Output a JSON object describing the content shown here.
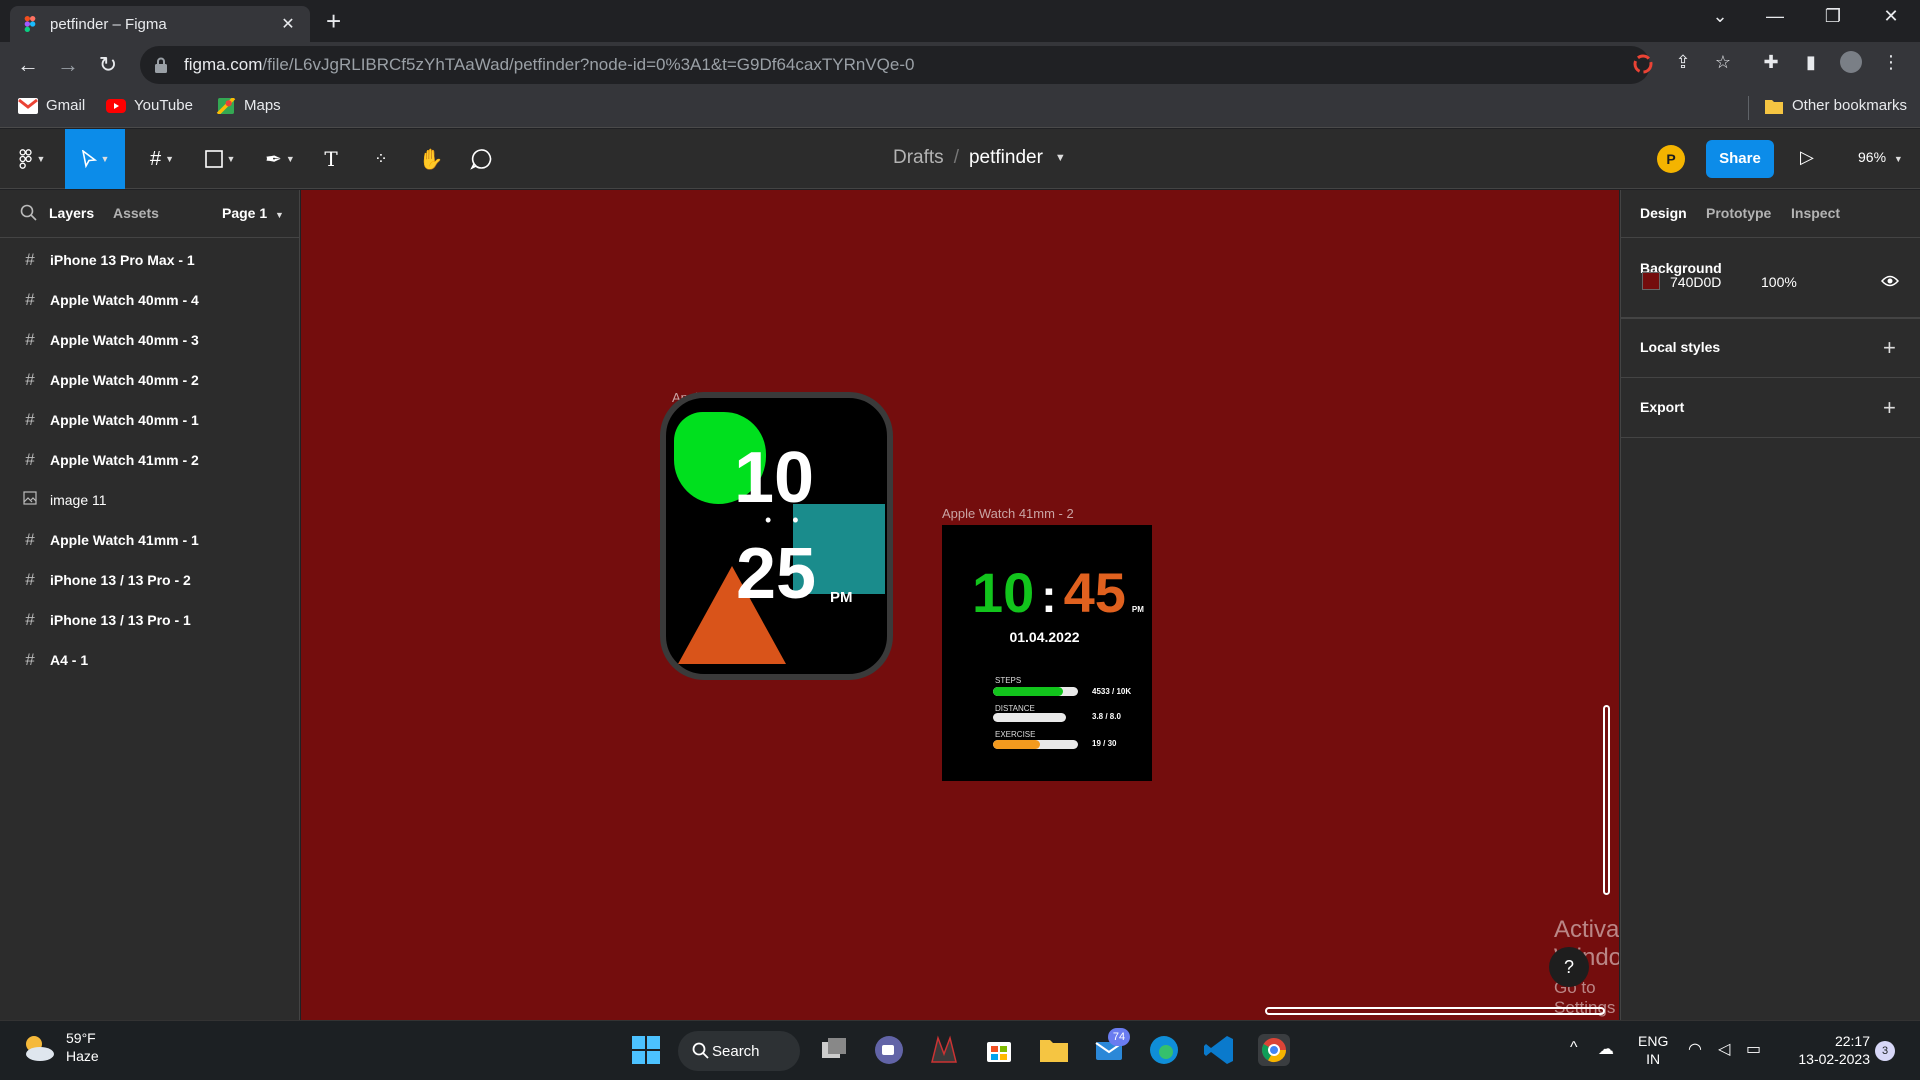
{
  "browser": {
    "tab_title": "petfinder – Figma",
    "url_host": "figma.com",
    "url_path": "/file/L6vJgRLIBRCf5zYhTAaWad/petfinder?node-id=0%3A1&t=G9Df64caxTYRnVQe-0",
    "bookmarks": [
      "Gmail",
      "YouTube",
      "Maps"
    ],
    "other_bookmarks": "Other bookmarks"
  },
  "figma_top": {
    "drafts": "Drafts",
    "slash": "/",
    "file_name": "petfinder",
    "avatar_initial": "P",
    "share_label": "Share",
    "zoom": "96%"
  },
  "left_panel": {
    "tabs": {
      "layers": "Layers",
      "assets": "Assets",
      "page": "Page 1"
    },
    "layers": [
      {
        "name": "iPhone 13 Pro Max - 1",
        "icon": "frame-icon"
      },
      {
        "name": "Apple Watch 40mm - 4",
        "icon": "frame-icon"
      },
      {
        "name": "Apple Watch 40mm - 3",
        "icon": "frame-icon"
      },
      {
        "name": "Apple Watch 40mm - 2",
        "icon": "frame-icon"
      },
      {
        "name": "Apple Watch 40mm - 1",
        "icon": "frame-icon"
      },
      {
        "name": "Apple Watch 41mm - 2",
        "icon": "frame-icon"
      },
      {
        "name": "image 11",
        "icon": "image-icon"
      },
      {
        "name": "Apple Watch 41mm - 1",
        "icon": "frame-icon"
      },
      {
        "name": "iPhone 13 / 13 Pro - 2",
        "icon": "frame-icon"
      },
      {
        "name": "iPhone 13 / 13 Pro - 1",
        "icon": "frame-icon"
      },
      {
        "name": "A4 - 1",
        "icon": "frame-icon"
      }
    ]
  },
  "canvas": {
    "background": "#740D0D",
    "watch1": {
      "label": "Apple Watch 41mm - 1",
      "hour": "10",
      "minute": "25",
      "ampm": "PM",
      "dots": "• •"
    },
    "watch2": {
      "label": "Apple Watch 41mm - 2",
      "hour": "10",
      "colon": ":",
      "minute": "45",
      "ampm": "PM",
      "date": "01.04.2022",
      "stats": [
        {
          "label": "STEPS",
          "value": "4533 / 10K",
          "fraction": 0.82,
          "color": "#12c41c"
        },
        {
          "label": "DISTANCE",
          "value": "3.8 / 8.0",
          "fraction": 0.0,
          "color": "#12c41c"
        },
        {
          "label": "EXERCISE",
          "value": "19 / 30",
          "fraction": 0.55,
          "color": "#f39a1e"
        }
      ]
    },
    "activate": {
      "title": "Activate Windows",
      "subtitle": "Go to Settings to activate Windows."
    },
    "help": "?"
  },
  "right_panel": {
    "tabs": [
      "Design",
      "Prototype",
      "Inspect"
    ],
    "background_title": "Background",
    "bg_hex": "740D0D",
    "bg_opacity": "100%",
    "local_styles": "Local styles",
    "export": "Export"
  },
  "taskbar": {
    "temp": "59°F",
    "condition": "Haze",
    "search_label": "Search",
    "mail_badge": "74",
    "lang1": "ENG",
    "lang2": "IN",
    "time": "22:17",
    "date": "13-02-2023",
    "notif_count": "3"
  }
}
